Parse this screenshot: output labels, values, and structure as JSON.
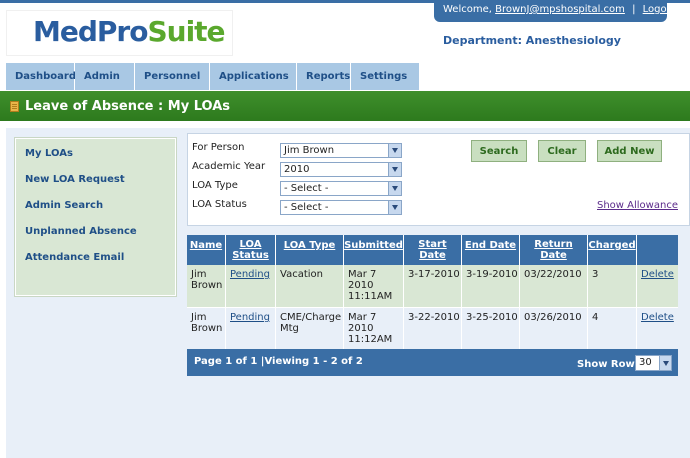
{
  "logo": {
    "part1": "MedPro",
    "part2": "Suite"
  },
  "header": {
    "welcome_label": "Welcome,",
    "user_email": "BrownJ@mpshospital.com",
    "separator": "|",
    "logout_label": "Logout",
    "department": "Department: Anesthesiology"
  },
  "nav": {
    "items": [
      {
        "label": "Dashboard"
      },
      {
        "label": "Admin"
      },
      {
        "label": "Personnel"
      },
      {
        "label": "Applications"
      },
      {
        "label": "Reports"
      },
      {
        "label": "Settings"
      }
    ]
  },
  "page": {
    "title": "Leave of Absence : My LOAs",
    "title_icon": "document-icon"
  },
  "sidebar": {
    "items": [
      {
        "label": "My LOAs"
      },
      {
        "label": "New LOA Request"
      },
      {
        "label": "Admin Search"
      },
      {
        "label": "Unplanned Absence"
      },
      {
        "label": "Attendance Email"
      }
    ]
  },
  "filters": {
    "person": {
      "label": "For Person",
      "value": "Jim Brown"
    },
    "year": {
      "label": "Academic Year",
      "value": "2010"
    },
    "loa_type": {
      "label": "LOA Type",
      "value": "- Select -"
    },
    "loa_status": {
      "label": "LOA Status",
      "value": "- Select -"
    }
  },
  "buttons": {
    "search": "Search",
    "clear": "Clear",
    "add_new": "Add New"
  },
  "show_allowance": "Show Allowance",
  "grid": {
    "headers": [
      "Name",
      "LOA Status",
      "LOA Type",
      "Submitted",
      "Start Date",
      "End Date",
      "Return Date",
      "Charged",
      ""
    ],
    "rows": [
      {
        "name": "Jim Brown",
        "status": "Pending",
        "type": "Vacation",
        "submitted": "Mar 7 2010 11:11AM",
        "start": "3-17-2010",
        "end": "3-19-2010",
        "return": "03/22/2010",
        "charged": "3",
        "action": "Delete"
      },
      {
        "name": "Jim Brown",
        "status": "Pending",
        "type": "CME/Charge Mtg",
        "submitted": "Mar 7 2010 11:12AM",
        "start": "3-22-2010",
        "end": "3-25-2010",
        "return": "03/26/2010",
        "charged": "4",
        "action": "Delete"
      }
    ],
    "footer": {
      "page_info": "Page 1 of 1 |Viewing 1 - 2 of 2",
      "show_rows_label": "Show Rows",
      "rows_value": "30"
    }
  },
  "colors": {
    "brand_blue": "#3a6ea5",
    "brand_green": "#2d7a1d",
    "light_green": "#d9e7d4",
    "nav_blue": "#a9c8e4"
  }
}
